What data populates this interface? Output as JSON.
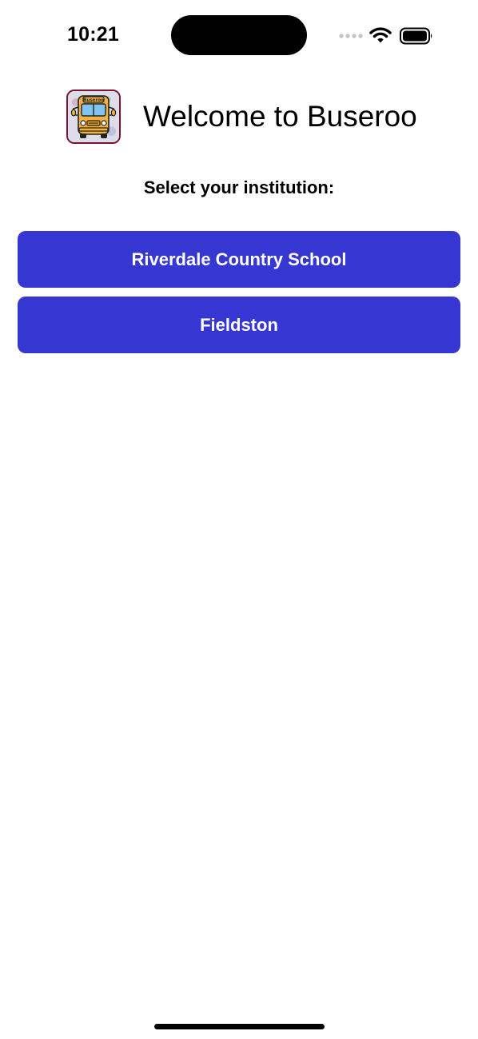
{
  "status_bar": {
    "time": "10:21",
    "signal_icon": "cellular-signal-icon",
    "wifi_icon": "wifi-icon",
    "battery_icon": "battery-full-icon"
  },
  "header": {
    "logo_icon": "school-bus-logo-icon",
    "logo_text": "Buseroo",
    "title": "Welcome to Buseroo"
  },
  "main": {
    "prompt": "Select your institution:",
    "institutions": [
      {
        "label": "Riverdale Country School"
      },
      {
        "label": "Fieldston"
      }
    ]
  },
  "colors": {
    "button_background": "#3636d3",
    "button_text": "#ffffff",
    "logo_border": "#7a1431",
    "bus_yellow": "#f4b23c"
  }
}
